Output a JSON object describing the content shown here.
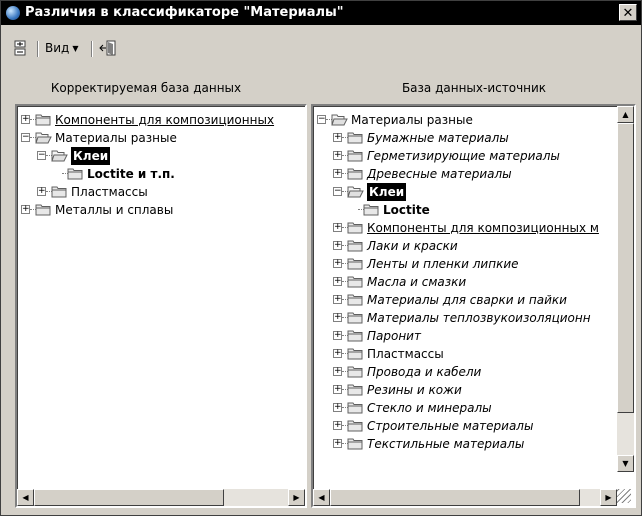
{
  "window": {
    "title": "Различия в классификаторе \"Материалы\"",
    "close_label": "✕"
  },
  "toolbar": {
    "view_label": "Вид"
  },
  "left": {
    "header": "Корректируемая база данных",
    "tree": [
      {
        "label": "Компоненты для композиционных",
        "style": "ul",
        "level": 0,
        "toggle": "+",
        "open": false
      },
      {
        "label": "Материалы разные",
        "style": "normal",
        "level": 0,
        "toggle": "-",
        "open": true
      },
      {
        "label": "Клеи",
        "style": "sel",
        "level": 1,
        "toggle": "-",
        "open": true
      },
      {
        "label": "Loctite и т.п.",
        "style": "bold",
        "level": 2,
        "toggle": "",
        "open": false
      },
      {
        "label": "Пластмассы",
        "style": "normal",
        "level": 1,
        "toggle": "+",
        "open": false
      },
      {
        "label": "Металлы и сплавы",
        "style": "normal",
        "level": 0,
        "toggle": "+",
        "open": false
      }
    ]
  },
  "right": {
    "header": "База данных-источник",
    "tree": [
      {
        "label": "Материалы разные",
        "style": "normal",
        "level": 0,
        "toggle": "-",
        "open": true
      },
      {
        "label": "Бумажные материалы",
        "style": "ital",
        "level": 1,
        "toggle": "+",
        "open": false
      },
      {
        "label": "Герметизирующие материалы",
        "style": "ital",
        "level": 1,
        "toggle": "+",
        "open": false
      },
      {
        "label": "Древесные материалы",
        "style": "ital",
        "level": 1,
        "toggle": "+",
        "open": false
      },
      {
        "label": "Клеи",
        "style": "sel",
        "level": 1,
        "toggle": "-",
        "open": true
      },
      {
        "label": "Loctite",
        "style": "bold",
        "level": 2,
        "toggle": "",
        "open": false
      },
      {
        "label": "Компоненты для композиционных м",
        "style": "ul",
        "level": 1,
        "toggle": "+",
        "open": false
      },
      {
        "label": "Лаки и краски",
        "style": "ital",
        "level": 1,
        "toggle": "+",
        "open": false
      },
      {
        "label": "Ленты и пленки липкие",
        "style": "ital",
        "level": 1,
        "toggle": "+",
        "open": false
      },
      {
        "label": "Масла и смазки",
        "style": "ital",
        "level": 1,
        "toggle": "+",
        "open": false
      },
      {
        "label": "Материалы для сварки и пайки",
        "style": "ital",
        "level": 1,
        "toggle": "+",
        "open": false
      },
      {
        "label": "Материалы теплозвукоизоляционн",
        "style": "ital",
        "level": 1,
        "toggle": "+",
        "open": false
      },
      {
        "label": "Паронит",
        "style": "ital",
        "level": 1,
        "toggle": "+",
        "open": false
      },
      {
        "label": "Пластмассы",
        "style": "normal",
        "level": 1,
        "toggle": "+",
        "open": false
      },
      {
        "label": "Провода и кабели",
        "style": "ital",
        "level": 1,
        "toggle": "+",
        "open": false
      },
      {
        "label": "Резины и кожи",
        "style": "ital",
        "level": 1,
        "toggle": "+",
        "open": false
      },
      {
        "label": "Стекло и минералы",
        "style": "ital",
        "level": 1,
        "toggle": "+",
        "open": false
      },
      {
        "label": "Строительные материалы",
        "style": "ital",
        "level": 1,
        "toggle": "+",
        "open": false
      },
      {
        "label": "Текстильные материалы",
        "style": "ital",
        "level": 1,
        "toggle": "+",
        "open": false
      }
    ]
  },
  "scroll": {
    "left_arrow": "◀",
    "right_arrow": "▶",
    "up_arrow": "▲",
    "down_arrow": "▼"
  }
}
